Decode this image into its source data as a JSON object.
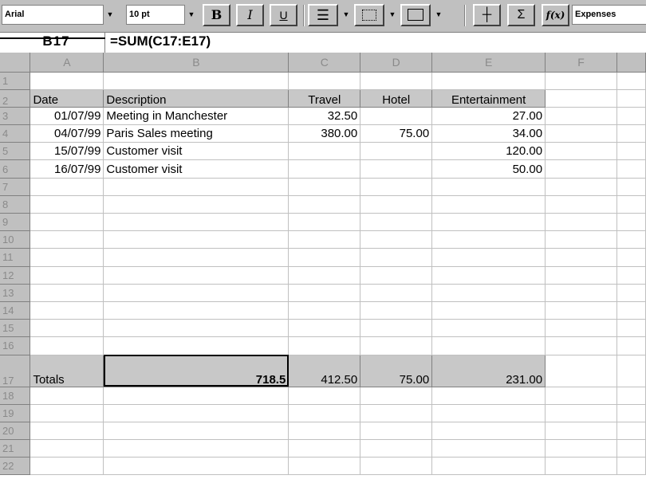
{
  "toolbar": {
    "font_name": "Arial",
    "font_size": "10 pt",
    "bold_label": "B",
    "italic_label": "I",
    "underline_label": "U",
    "sum_label": "Σ",
    "function_label": "f(x)",
    "sheet_name": "Expenses",
    "icons": [
      "dropdown-arrow-icon",
      "bold-icon",
      "italic-icon",
      "underline-icon",
      "align-icon",
      "border-icon",
      "fill-icon",
      "column-icon",
      "sum-icon",
      "function-icon"
    ]
  },
  "formula_bar": {
    "cell_reference": "B17",
    "formula": "=SUM(C17:E17)"
  },
  "sheet": {
    "columns": [
      "A",
      "B",
      "C",
      "D",
      "E",
      "F"
    ],
    "row_numbers": [
      "1",
      "2",
      "3",
      "4",
      "5",
      "6",
      "7",
      "8",
      "9",
      "10",
      "11",
      "12",
      "13",
      "14",
      "15",
      "16",
      "17",
      "18",
      "19",
      "20",
      "21",
      "22"
    ],
    "headers": {
      "date": "Date",
      "description": "Description",
      "travel": "Travel",
      "hotel": "Hotel",
      "entertainment": "Entertainment"
    },
    "rows": [
      {
        "date": "01/07/99",
        "description": "Meeting in Manchester",
        "travel": "32.50",
        "hotel": "",
        "entertainment": "27.00"
      },
      {
        "date": "04/07/99",
        "description": "Paris Sales meeting",
        "travel": "380.00",
        "hotel": "75.00",
        "entertainment": "34.00"
      },
      {
        "date": "15/07/99",
        "description": "Customer visit",
        "travel": "",
        "hotel": "",
        "entertainment": "120.00"
      },
      {
        "date": "16/07/99",
        "description": "Customer visit",
        "travel": "",
        "hotel": "",
        "entertainment": "50.00"
      }
    ],
    "totals": {
      "label": "Totals",
      "grand_total": "718.5",
      "travel": "412.50",
      "hotel": "75.00",
      "entertainment": "231.00"
    }
  },
  "colors": {
    "toolbar_bg": "#c0c0c0",
    "header_fill": "#c8c8c8",
    "gridline": "#c0c0c0"
  }
}
